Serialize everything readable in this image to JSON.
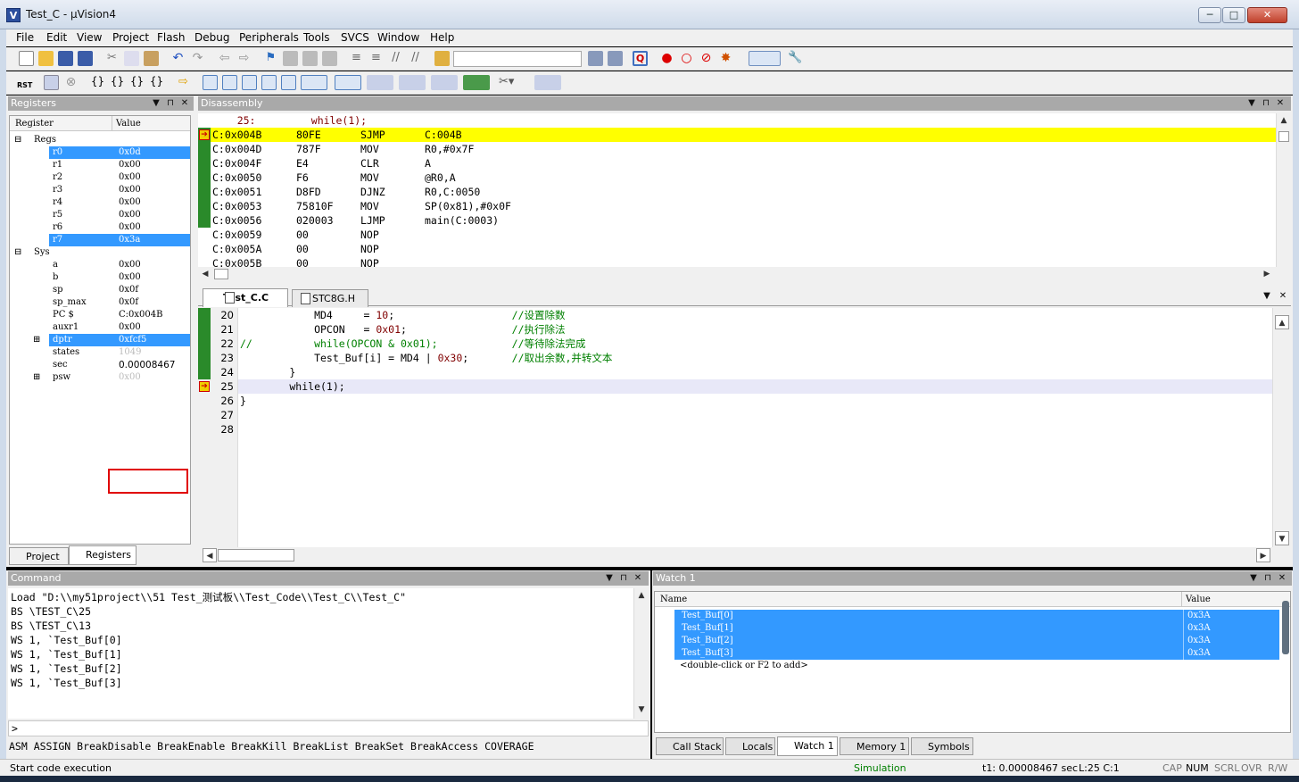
{
  "window": {
    "title": "Test_C  - µVision4",
    "min": "─",
    "max": "□",
    "close": "✕",
    "app_icon": "V"
  },
  "menus": [
    "File",
    "Edit",
    "View",
    "Project",
    "Flash",
    "Debug",
    "Peripherals",
    "Tools",
    "SVCS",
    "Window",
    "Help"
  ],
  "toolbar2": {
    "rst": "RST"
  },
  "registers": {
    "title": "Registers",
    "col_register": "Register",
    "col_value": "Value",
    "regs_group": "Regs",
    "regs": [
      [
        "r0",
        "0x0d"
      ],
      [
        "r1",
        "0x00"
      ],
      [
        "r2",
        "0x00"
      ],
      [
        "r3",
        "0x00"
      ],
      [
        "r4",
        "0x00"
      ],
      [
        "r5",
        "0x00"
      ],
      [
        "r6",
        "0x00"
      ],
      [
        "r7",
        "0x3a"
      ]
    ],
    "sys_group": "Sys",
    "sys": [
      [
        "a",
        "0x00"
      ],
      [
        "b",
        "0x00"
      ],
      [
        "sp",
        "0x0f"
      ],
      [
        "sp_max",
        "0x0f"
      ],
      [
        "PC  $",
        "C:0x004B"
      ],
      [
        "auxr1",
        "0x00"
      ],
      [
        "dptr",
        "0xfcf5"
      ],
      [
        "states",
        "1049"
      ],
      [
        "sec",
        "0.00008467"
      ],
      [
        "psw",
        "0x00"
      ]
    ],
    "tab_project": "Project",
    "tab_registers": "Registers"
  },
  "disassembly": {
    "title": "Disassembly",
    "source_line": "    25:         while(1);",
    "lines": [
      [
        "C:0x004B",
        "80FE",
        "SJMP",
        "C:004B"
      ],
      [
        "C:0x004D",
        "787F",
        "MOV",
        "R0,#0x7F"
      ],
      [
        "C:0x004F",
        "E4",
        "CLR",
        "A"
      ],
      [
        "C:0x0050",
        "F6",
        "MOV",
        "@R0,A"
      ],
      [
        "C:0x0051",
        "D8FD",
        "DJNZ",
        "R0,C:0050"
      ],
      [
        "C:0x0053",
        "75810F",
        "MOV",
        "SP(0x81),#0x0F"
      ],
      [
        "C:0x0056",
        "020003",
        "LJMP",
        "main(C:0003)"
      ],
      [
        "C:0x0059",
        "00",
        "NOP",
        ""
      ],
      [
        "C:0x005A",
        "00",
        "NOP",
        ""
      ],
      [
        "C:0x005B",
        "00",
        "NOP",
        ""
      ]
    ]
  },
  "editor": {
    "tabs": [
      "Test_C.C",
      "STC8G.H"
    ],
    "line_numbers": [
      "20",
      "21",
      "22",
      "23",
      "24",
      "25",
      "26",
      "27",
      "28"
    ],
    "l20": [
      "            MD4     = ",
      "10",
      ";                   ",
      "//设置除数"
    ],
    "l21": [
      "            OPCON   = ",
      "0x01",
      ";                 ",
      "//执行除法"
    ],
    "l22": [
      "//          while(OPCON & 0x01);            ",
      "//等待除法完成"
    ],
    "l23": [
      "            Test_Buf[i] = MD4 | ",
      "0x30",
      ";       ",
      "//取出余数,并转文本"
    ],
    "l24": "        }",
    "l25": "        while(1);",
    "l26": "}"
  },
  "command": {
    "title": "Command",
    "lines": [
      "Load \"D:\\\\my51project\\\\51 Test_测试板\\\\Test_Code\\\\Test_C\\\\Test_C\"",
      "BS \\TEST_C\\25",
      "BS \\TEST_C\\13",
      "WS 1, `Test_Buf[0]",
      "WS 1, `Test_Buf[1]",
      "WS 1, `Test_Buf[2]",
      "WS 1, `Test_Buf[3]"
    ],
    "prompt": ">",
    "keywords": "ASM ASSIGN BreakDisable BreakEnable BreakKill BreakList BreakSet BreakAccess COVERAGE"
  },
  "watch": {
    "title": "Watch 1",
    "col_name": "Name",
    "col_value": "Value",
    "rows": [
      [
        "Test_Buf[0]",
        "0x3A"
      ],
      [
        "Test_Buf[1]",
        "0x3A"
      ],
      [
        "Test_Buf[2]",
        "0x3A"
      ],
      [
        "Test_Buf[3]",
        "0x3A"
      ]
    ],
    "add_hint": "<double-click or F2 to add>",
    "tabs": [
      "Call Stack",
      "Locals",
      "Watch 1",
      "Memory 1",
      "Symbols"
    ]
  },
  "status": {
    "message": "Start code execution",
    "mode": "Simulation",
    "time": "t1: 0.00008467 sec",
    "pos": "L:25 C:1",
    "caps": "CAP",
    "num": "NUM",
    "scrl": "SCRL",
    "ovr": "OVR",
    "rw": "R/W"
  },
  "colors": {
    "selection": "#3399ff",
    "gutter": "#2a8a2a",
    "current_line": "#ffff00",
    "highlight_box": "#e00000"
  }
}
